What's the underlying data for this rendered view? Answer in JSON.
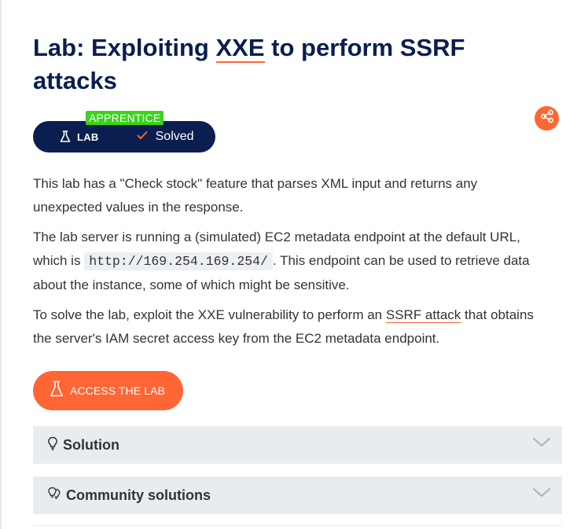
{
  "title": {
    "prefix": "Lab: Exploiting ",
    "link": "XXE",
    "suffix": " to perform SSRF attacks"
  },
  "status": {
    "level": "APPRENTICE",
    "type_label": "LAB",
    "state_label": "Solved"
  },
  "description": {
    "p1": "This lab has a \"Check stock\" feature that parses XML input and returns any unexpected values in the response.",
    "p2_before": "The lab server is running a (simulated) EC2 metadata endpoint at the default URL, which is ",
    "p2_code": "http://169.254.169.254/",
    "p2_after": ". This endpoint can be used to retrieve data about the instance, some of which might be sensitive.",
    "p3_before": "To solve the lab, exploit the XXE vulnerability to perform an ",
    "p3_link": "SSRF attack",
    "p3_after": " that obtains the server's IAM secret access key from the EC2 metadata endpoint."
  },
  "actions": {
    "access_lab": "ACCESS THE LAB"
  },
  "accordions": [
    {
      "label": "Solution",
      "icon": "lightbulb-icon"
    },
    {
      "label": "Community solutions",
      "icon": "community-bulbs-icon"
    }
  ],
  "colors": {
    "navy": "#0a1e4f",
    "accent": "#ff6633",
    "level_green": "#3bd31b",
    "accordion_bg": "#e9ecef"
  }
}
